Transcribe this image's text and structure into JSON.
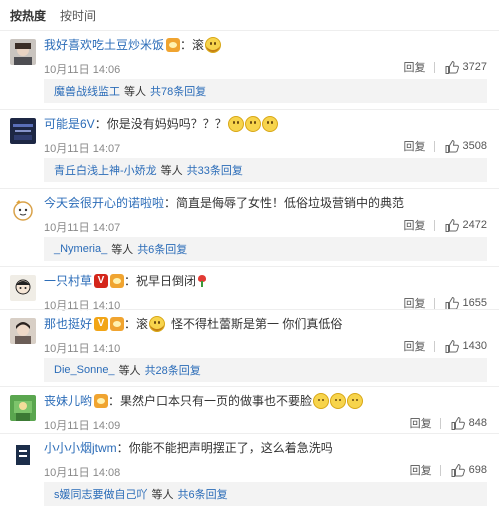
{
  "sort": {
    "hot": "按热度",
    "time": "按时间"
  },
  "colon": "：",
  "reply_label": "回复",
  "sub_mid": "等人",
  "comments": [
    {
      "user": "我好喜欢吃土豆炒米饭",
      "text": "滚",
      "time": "10月11日 14:06",
      "likes": "3727",
      "sub": {
        "user": "魔兽战线监工",
        "count": "共78条回复"
      }
    },
    {
      "user": "可能是6V",
      "text": "你是没有妈妈吗？？？",
      "time": "10月11日 14:07",
      "likes": "3508",
      "sub": {
        "user": "青丘白浅上神-小娇龙",
        "count": "共33条回复"
      }
    },
    {
      "user": "今天会很开心的诺啦啦",
      "text": "简直是侮辱了女性！低俗垃圾营销中的典范",
      "time": "10月11日 14:07",
      "likes": "2472",
      "sub": {
        "user": "_Nymeria_",
        "count": "共6条回复"
      }
    },
    {
      "user": "一只村草",
      "text": "祝早日倒闭",
      "time": "10月11日 14:10",
      "likes": "1655"
    },
    {
      "user": "那也挺好",
      "text": "滚",
      "text2": "怪不得杜蕾斯是第一 你们真低俗",
      "time": "10月11日 14:10",
      "likes": "1430",
      "sub": {
        "user": "Die_Sonne_",
        "count": "共28条回复"
      }
    },
    {
      "user": "丧妹儿哟",
      "text": "果然户口本只有一页的做事也不要脸",
      "time": "10月11日 14:09",
      "likes": "848"
    },
    {
      "user": "小小小烟jtwm",
      "text": "你能不能把声明摆正了，这么着急洗吗",
      "time": "10月11日 14:08",
      "likes": "698",
      "sub": {
        "user": "s媛同志要做自己吖",
        "count": "共6条回复"
      }
    }
  ]
}
